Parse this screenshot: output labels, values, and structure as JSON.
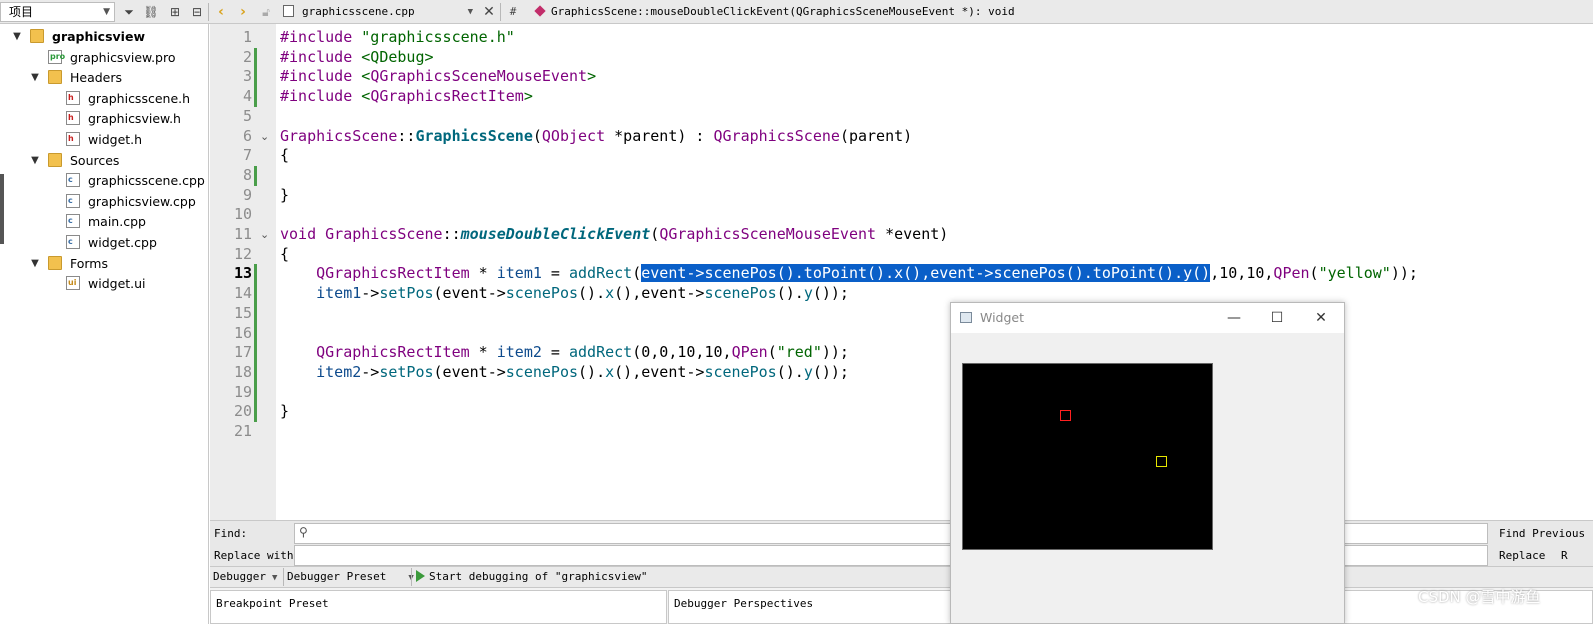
{
  "toolbar": {
    "project_label": "项目",
    "file_name": "graphicsscene.cpp",
    "hash": "#",
    "symbol": "GraphicsScene::mouseDoubleClickEvent(QGraphicsSceneMouseEvent *): void"
  },
  "sidebar": {
    "items": [
      {
        "label": "graphicsview",
        "type": "project-root"
      },
      {
        "label": "graphicsview.pro",
        "type": "pro"
      },
      {
        "label": "Headers",
        "type": "folder"
      },
      {
        "label": "graphicsscene.h",
        "type": "h"
      },
      {
        "label": "graphicsview.h",
        "type": "h"
      },
      {
        "label": "widget.h",
        "type": "h"
      },
      {
        "label": "Sources",
        "type": "folder"
      },
      {
        "label": "graphicsscene.cpp",
        "type": "cpp"
      },
      {
        "label": "graphicsview.cpp",
        "type": "cpp"
      },
      {
        "label": "main.cpp",
        "type": "cpp"
      },
      {
        "label": "widget.cpp",
        "type": "cpp"
      },
      {
        "label": "Forms",
        "type": "folder"
      },
      {
        "label": "widget.ui",
        "type": "ui"
      }
    ]
  },
  "editor": {
    "current_line": 13,
    "lines": [
      "#include \"graphicsscene.h\"",
      "#include <QDebug>",
      "#include <QGraphicsSceneMouseEvent>",
      "#include <QGraphicsRectItem>",
      "",
      "GraphicsScene::GraphicsScene(QObject *parent) : QGraphicsScene(parent)",
      "{",
      "",
      "}",
      "",
      "void GraphicsScene::mouseDoubleClickEvent(QGraphicsSceneMouseEvent *event)",
      "{",
      "    QGraphicsRectItem * item1 = addRect(event->scenePos().toPoint().x(),event->scenePos().toPoint().y(),10,10,QPen(\"yellow\"));",
      "    item1->setPos(event->scenePos().x(),event->scenePos().y());",
      "",
      "",
      "    QGraphicsRectItem * item2 = addRect(0,0,10,10,QPen(\"red\"));",
      "    item2->setPos(event->scenePos().x(),event->scenePos().y());",
      "",
      "}",
      ""
    ]
  },
  "find": {
    "find_label": "Find:",
    "replace_label": "Replace with:",
    "find_previous": "Find Previous",
    "replace": "Replace",
    "replace_cut": "R"
  },
  "debugger": {
    "debugger_label": "Debugger",
    "preset_label": "Debugger Preset",
    "start_label": "Start debugging of \"graphicsview\"",
    "breakpoint_preset": "Breakpoint Preset",
    "perspectives": "Debugger Perspectives"
  },
  "widget_window": {
    "title": "Widget",
    "minimize": "—",
    "maximize": "☐",
    "close": "✕",
    "rects": [
      {
        "color": "#ff2020",
        "label": "red"
      },
      {
        "color": "#e6e600",
        "label": "yellow"
      }
    ]
  },
  "watermark": "CSDN @雪中游鱼"
}
